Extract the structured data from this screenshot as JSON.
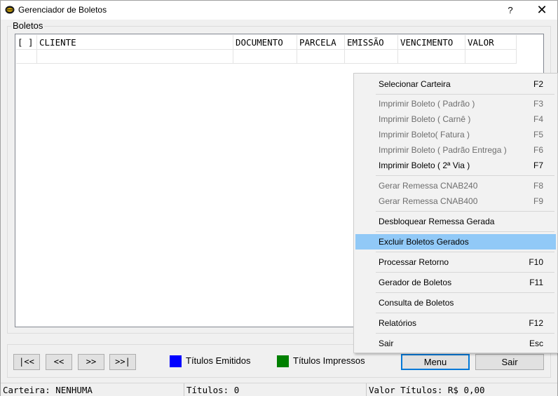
{
  "window": {
    "title": "Gerenciador de Boletos",
    "help_label": "?",
    "close_label": "✕"
  },
  "group": {
    "title": "Boletos"
  },
  "grid": {
    "columns": [
      "[ ]",
      "CLIENTE",
      "DOCUMENTO",
      "PARCELA",
      "EMISSÃO",
      "VENCIMENTO",
      "VALOR"
    ]
  },
  "nav": {
    "first": "|<<",
    "prev": "<<",
    "next": ">>",
    "last": ">>|"
  },
  "legend": {
    "emitidos": {
      "label": "Títulos Emitidos",
      "color": "#0000ff"
    },
    "impressos": {
      "label": "Títulos Impressos",
      "color": "#008000"
    }
  },
  "buttons": {
    "menu": "Menu",
    "sair": "Sair"
  },
  "status": {
    "carteira": "Carteira: NENHUMA",
    "titulos": "Títulos: 0",
    "valor": "Valor Títulos: R$ 0,00"
  },
  "context_menu": {
    "items": [
      {
        "label": "Selecionar Carteira",
        "shortcut": "F2"
      },
      {
        "label": "Imprimir Boleto ( Padrão )",
        "shortcut": "F3"
      },
      {
        "label": "Imprimir Boleto ( Carnê )",
        "shortcut": "F4"
      },
      {
        "label": "Imprimir Boleto( Fatura )",
        "shortcut": "F5"
      },
      {
        "label": "Imprimir Boleto ( Padrão Entrega )",
        "shortcut": "F6"
      },
      {
        "label": "Imprimir Boleto ( 2ª Via )",
        "shortcut": "F7"
      },
      {
        "label": "Gerar Remessa CNAB240",
        "shortcut": "F8"
      },
      {
        "label": "Gerar Remessa CNAB400",
        "shortcut": "F9"
      },
      {
        "label": "Desbloquear Remessa Gerada",
        "shortcut": ""
      },
      {
        "label": "Excluir Boletos Gerados",
        "shortcut": ""
      },
      {
        "label": "Processar Retorno",
        "shortcut": "F10"
      },
      {
        "label": "Gerador de Boletos",
        "shortcut": "F11"
      },
      {
        "label": "Consulta de Boletos",
        "shortcut": ""
      },
      {
        "label": "Relatórios",
        "shortcut": "F12"
      },
      {
        "label": "Sair",
        "shortcut": "Esc"
      }
    ],
    "highlight_color": "#91c9f7",
    "disabled_color": "#6d6d6d"
  }
}
